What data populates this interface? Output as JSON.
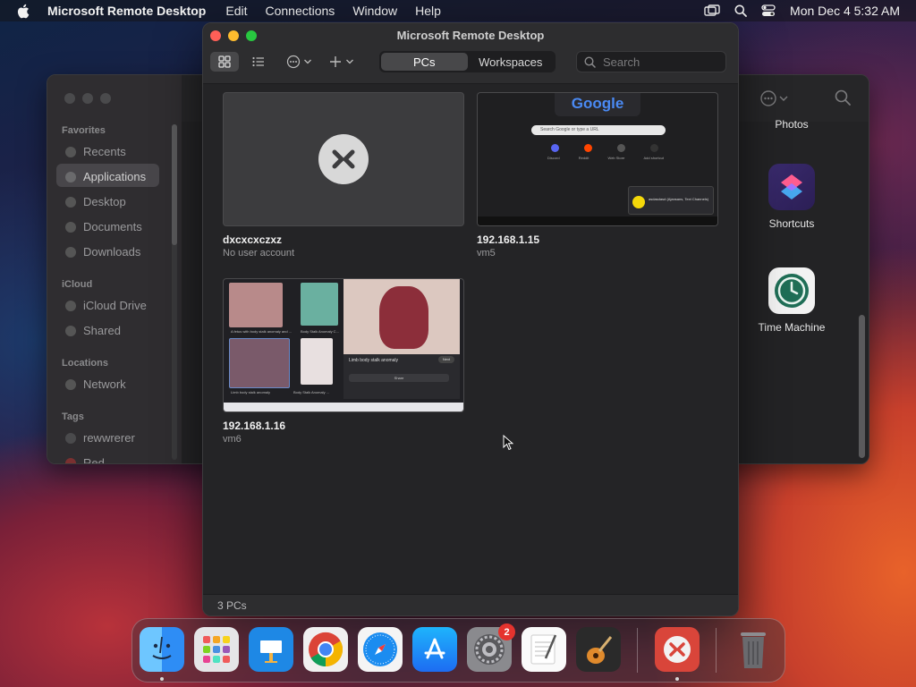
{
  "menubar": {
    "app_name": "Microsoft Remote Desktop",
    "menus": [
      "Edit",
      "Connections",
      "Window",
      "Help"
    ],
    "clock": "Mon Dec 4  5:32 AM",
    "icons": [
      "apple-icon",
      "screen-mirror-icon",
      "search-icon",
      "control-center-icon"
    ]
  },
  "finder": {
    "sidebar": {
      "favorites_title": "Favorites",
      "favorites": [
        "Recents",
        "Applications",
        "Desktop",
        "Documents",
        "Downloads"
      ],
      "selected": "Applications",
      "icloud_title": "iCloud",
      "icloud": [
        "iCloud Drive",
        "Shared"
      ],
      "locations_title": "Locations",
      "locations": [
        "Network"
      ],
      "tags_title": "Tags",
      "tags": [
        "rewwrerer",
        "Red"
      ]
    },
    "apps": [
      {
        "name": "Photos"
      },
      {
        "name": "Shortcuts"
      },
      {
        "name": "Time Machine"
      }
    ]
  },
  "rd_window": {
    "title": "Microsoft Remote Desktop",
    "tabs": [
      "PCs",
      "Workspaces"
    ],
    "active_tab": "PCs",
    "search_placeholder": "Search",
    "pcs": [
      {
        "name": "dxcxcxczxz",
        "subtitle": "No user account"
      },
      {
        "name": "192.168.1.15",
        "subtitle": "vm5"
      },
      {
        "name": "192.168.1.16",
        "subtitle": "vm6"
      }
    ],
    "footer": "3 PCs",
    "thumb_text": {
      "google_logo": "Google",
      "google_search_placeholder": "Search Google or type a URL",
      "notification_title": "asdasdasd (Ajansans, Text Channels)",
      "shortcuts": [
        "Discord",
        "Reddit",
        "Web Store",
        "Add shortcut"
      ],
      "photo_caption_1": "A fetus with body stalk anomaly and ...",
      "photo_caption_2": "Body Stalk Anomaly C...",
      "photo_caption_3": "Limb body stalk anomaly",
      "photo_caption_4": "Body Stalk Anomaly ...",
      "dialog_title": "Limb body stalk anomaly",
      "dialog_button": "Next",
      "dialog_share": "Share"
    }
  },
  "dock": {
    "items": [
      "Finder",
      "Launchpad",
      "Keynote",
      "Google Chrome",
      "Safari",
      "App Store",
      "System Settings",
      "TextEdit",
      "GarageBand",
      "Microsoft Remote Desktop",
      "Trash"
    ],
    "system_settings_badge": "2"
  },
  "colors": {
    "close": "#fe5f57",
    "minimize": "#febc2e",
    "maximize": "#28c840",
    "rd_brand": "#d9453a"
  }
}
